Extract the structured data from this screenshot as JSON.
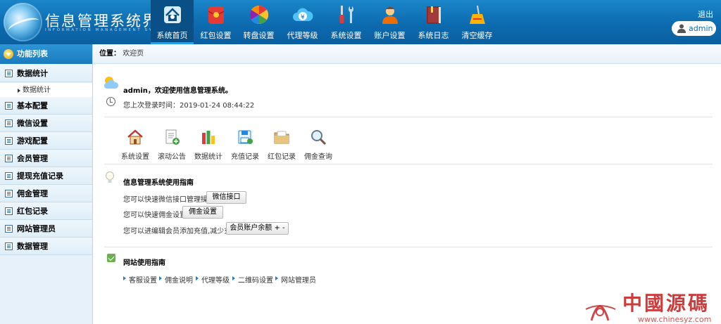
{
  "header": {
    "title": "信息管理系统界面",
    "subtitle": "INFORMATION MANAGEMENT SYSTEM GUI",
    "logout_label": "退出",
    "user_name": "admin",
    "nav": [
      {
        "label": "系统首页",
        "icon": "home-icon",
        "active": true
      },
      {
        "label": "红包设置",
        "icon": "red-packet-icon",
        "active": false
      },
      {
        "label": "转盘设置",
        "icon": "wheel-icon",
        "active": false
      },
      {
        "label": "代理等级",
        "icon": "yen-cloud-icon",
        "active": false
      },
      {
        "label": "系统设置",
        "icon": "tools-icon",
        "active": false
      },
      {
        "label": "账户设置",
        "icon": "user-icon",
        "active": false
      },
      {
        "label": "系统日志",
        "icon": "book-icon",
        "active": false
      },
      {
        "label": "清空缓存",
        "icon": "broom-icon",
        "active": false
      }
    ]
  },
  "sidebar": {
    "title": "功能列表",
    "items": [
      {
        "label": "数据统计",
        "children": [
          "数据统计"
        ]
      },
      {
        "label": "基本配置"
      },
      {
        "label": "微信设置"
      },
      {
        "label": "游戏配置"
      },
      {
        "label": "会员管理"
      },
      {
        "label": "提现充值记录"
      },
      {
        "label": "佣金管理"
      },
      {
        "label": "红包记录"
      },
      {
        "label": "网站管理员"
      },
      {
        "label": "数据管理"
      }
    ]
  },
  "breadcrumb": {
    "prefix": "位置：",
    "current": "欢迎页"
  },
  "welcome": {
    "message": "admin，欢迎使用信息管理系统。",
    "last_login": "您上次登录时间：2019-01-24 08:44:22"
  },
  "quick_links": [
    {
      "label": "系统设置",
      "icon": "house-icon"
    },
    {
      "label": "滚动公告",
      "icon": "document-add-icon"
    },
    {
      "label": "数据统计",
      "icon": "bar-chart-icon"
    },
    {
      "label": "充值记录",
      "icon": "floppy-icon"
    },
    {
      "label": "红包记录",
      "icon": "folder-icon"
    },
    {
      "label": "佣金查询",
      "icon": "magnifier-icon"
    }
  ],
  "guide": {
    "title": "信息管理系统使用指南",
    "rows": [
      {
        "text": "您可以快速微信接口管理操作",
        "button": "微信接口"
      },
      {
        "text": "您可以快速佣金设置",
        "button": "佣金设置"
      },
      {
        "text": "您可以进编辑会员添加充值,减少充值",
        "button": "会员账户余额 + -"
      }
    ]
  },
  "site_guide": {
    "title": "网站使用指南",
    "links": [
      "客服设置",
      "佣金说明",
      "代理等级",
      "二维码设置",
      "网站管理员"
    ]
  },
  "watermark": {
    "text": "中國源碼",
    "url": "www.chinesyz.com"
  },
  "colors": {
    "header": "#0d6bb0",
    "active_nav": "#0a4f86",
    "sidebar_bg": "#e6f1f9",
    "watermark": "#c62828"
  }
}
